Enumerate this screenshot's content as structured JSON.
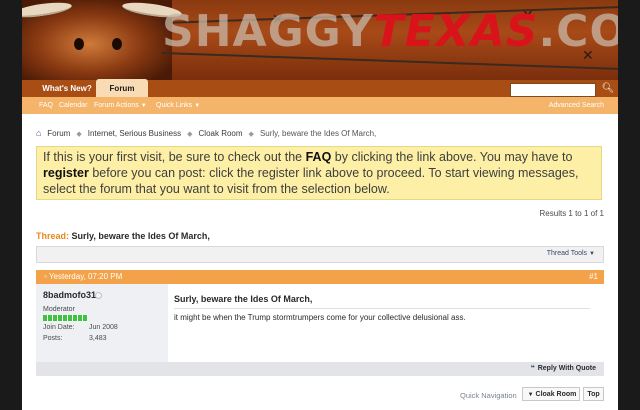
{
  "brand": {
    "logo_part1": "SHAGGY",
    "logo_part2": "TEXAS",
    "logo_part3": ".COM"
  },
  "nav": {
    "tabs": [
      {
        "label": "What's New?"
      },
      {
        "label": "Forum"
      }
    ],
    "sub_links": [
      {
        "label": "FAQ"
      },
      {
        "label": "Calendar"
      },
      {
        "label": "Forum Actions"
      },
      {
        "label": "Quick Links"
      }
    ],
    "advanced_search": "Advanced Search",
    "search_value": ""
  },
  "breadcrumb": {
    "items": [
      "Forum",
      "Internet, Serious Business",
      "Cloak Room"
    ],
    "current": "Surly, beware the Ides Of March,"
  },
  "notice": {
    "part1": "If this is your first visit, be sure to check out the ",
    "faq": "FAQ",
    "part2": " by clicking the link above. You may have to ",
    "register": "register",
    "part3": " before you can post: click the register link above to proceed. To start viewing messages, select the forum that you want to visit from the selection below."
  },
  "results": "Results 1 to 1 of 1",
  "thread": {
    "label": "Thread:",
    "title": "Surly, beware the Ides Of March,",
    "tools": "Thread Tools"
  },
  "post": {
    "date": "Yesterday, 07:20 PM",
    "number": "#1",
    "username": "8badmofo31",
    "user_title": "Moderator",
    "join_label": "Join Date:",
    "join_value": "Jun 2008",
    "posts_label": "Posts:",
    "posts_value": "3,483",
    "title": "Surly, beware the Ides Of March,",
    "text": "it might be when the Trump stormtrumpers come for your collective delusional ass.",
    "reply_quote": "Reply With Quote"
  },
  "quick_nav": {
    "label": "Quick Navigation",
    "forum": "Cloak Room",
    "top": "Top"
  },
  "colors": {
    "nav_orange": "#a84d14",
    "sub_nav": "#f4b46a",
    "post_header": "#f4a24a",
    "notice_bg": "#fdf0a6",
    "accent_texas": "#d8141a"
  }
}
